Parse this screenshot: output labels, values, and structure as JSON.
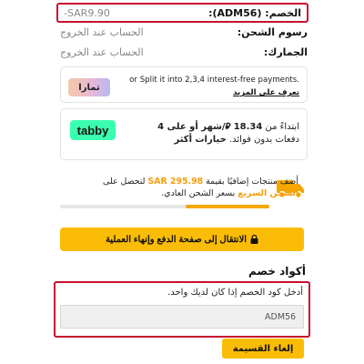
{
  "summary": {
    "discount_label": "الخصم: (ADM56):",
    "discount_value": "-SAR9.90",
    "shipping_label": "رسوم الشحن:",
    "shipping_value": "الحساب عند الخروج",
    "customs_label": "الجمارك:",
    "customs_value": "الحساب عند الخروج"
  },
  "tamara": {
    "logo_text": "تمارا",
    "text": "or Split it into 2,3,4 interest-free payments.",
    "link": "تعرف على المزيد"
  },
  "tabby": {
    "logo_text": "tabby",
    "line1_start": "ابتداءً من",
    "amount": "18.34",
    "line1_end": "⃁/شهر أو على 4",
    "line2_start": "دفعات بدون فوائد.",
    "line2_bold": "خيارات أكثر"
  },
  "free_shipping": {
    "line1_start": "أضف منتجات إضافيًا بقيمة",
    "amount": "SAR 295.98",
    "line1_end": "لتحصل على",
    "line2_highlight": "الشحن السريع",
    "line2_end": "بسعر الشحن العادي.",
    "progress": 0.4
  },
  "checkout": {
    "button_label": "الانتقال إلى صفحة الدفع وإنهاء العملية"
  },
  "coupon": {
    "title": "أكواد خصم",
    "hint": "أدخل كود الخصم إذا كان لديك واحد.",
    "value": "ADM56",
    "cancel_label": "إلغاء القسيمة"
  },
  "colors": {
    "accent": "#fbbc05",
    "highlight_border": "#c8102e",
    "tabby_green": "#3bffb0"
  }
}
